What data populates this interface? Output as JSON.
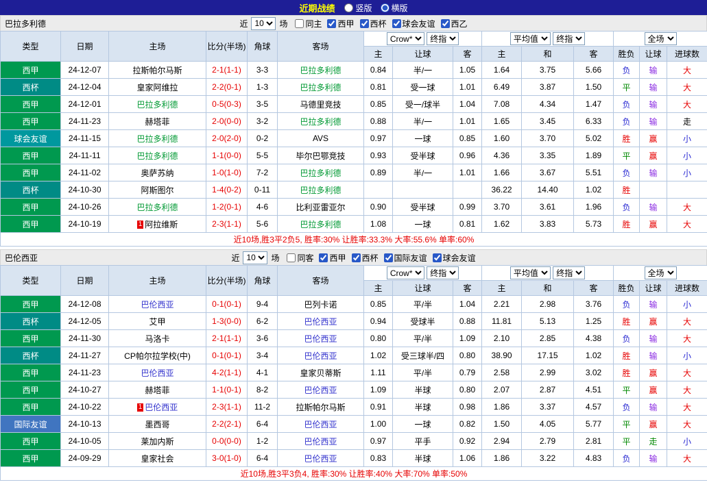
{
  "topbar": {
    "title": "近期战绩",
    "radio_options": [
      {
        "label": "竖版",
        "selected": false
      },
      {
        "label": "横版",
        "selected": true
      }
    ]
  },
  "table_header": {
    "fixed": [
      "类型",
      "日期",
      "主场",
      "比分(半场)",
      "角球",
      "客场"
    ],
    "group1": {
      "selects": [
        "Crow*",
        "终指"
      ],
      "sub": [
        "主",
        "让球",
        "客"
      ]
    },
    "group2": {
      "selects": [
        "平均值",
        "终指"
      ],
      "sub": [
        "主",
        "和",
        "客"
      ]
    },
    "group3": {
      "selects": [
        "全场"
      ],
      "sub": [
        "胜负",
        "让球",
        "进球数"
      ]
    }
  },
  "colors": {
    "accent": "#2858c8",
    "score": "#e60000",
    "league": {
      "西甲": "#00994f",
      "西杯": "#008b85",
      "球会友谊": "#00989e",
      "国际友谊": "#4075c0"
    },
    "result": {
      "胜": "#e60000",
      "平": "#008800",
      "负": "#2a2ad2"
    },
    "handicap": {
      "赢": "#e60000",
      "输": "#8a2be2",
      "走": "#008800"
    },
    "goals": {
      "大": "#e60000",
      "小": "#2a2ad2"
    }
  },
  "sections": [
    {
      "team": "巴拉多利德",
      "team_color": "#009933",
      "filter": {
        "prefix": "近",
        "count": "10",
        "suffix": "场",
        "checkboxes": [
          {
            "label": "同主",
            "checked": false
          },
          {
            "label": "西甲",
            "checked": true
          },
          {
            "label": "西杯",
            "checked": true
          },
          {
            "label": "球会友谊",
            "checked": true
          },
          {
            "label": "西乙",
            "checked": true
          }
        ]
      },
      "rows": [
        {
          "league": "西甲",
          "date": "24-12-07",
          "home": "拉斯帕尔马斯",
          "home_is_team": false,
          "score": "2-1(1-1)",
          "corner": "3-3",
          "away": "巴拉多利德",
          "away_is_team": true,
          "asia": [
            "0.84",
            "半/一",
            "1.05"
          ],
          "europe": [
            "1.64",
            "3.75",
            "5.66"
          ],
          "result": "负",
          "handicap": "输",
          "goals": "大"
        },
        {
          "league": "西杯",
          "date": "24-12-04",
          "home": "皇家阿维拉",
          "home_is_team": false,
          "score": "2-2(0-1)",
          "corner": "1-3",
          "away": "巴拉多利德",
          "away_is_team": true,
          "asia": [
            "0.81",
            "受一球",
            "1.01"
          ],
          "europe": [
            "6.49",
            "3.87",
            "1.50"
          ],
          "result": "平",
          "handicap": "输",
          "goals": "大"
        },
        {
          "league": "西甲",
          "date": "24-12-01",
          "home": "巴拉多利德",
          "home_is_team": true,
          "score": "0-5(0-3)",
          "corner": "3-5",
          "away": "马德里竞技",
          "away_is_team": false,
          "asia": [
            "0.85",
            "受一/球半",
            "1.04"
          ],
          "europe": [
            "7.08",
            "4.34",
            "1.47"
          ],
          "result": "负",
          "handicap": "输",
          "goals": "大"
        },
        {
          "league": "西甲",
          "date": "24-11-23",
          "home": "赫塔菲",
          "home_is_team": false,
          "score": "2-0(0-0)",
          "corner": "3-2",
          "away": "巴拉多利德",
          "away_is_team": true,
          "asia": [
            "0.88",
            "半/一",
            "1.01"
          ],
          "europe": [
            "1.65",
            "3.45",
            "6.33"
          ],
          "result": "负",
          "handicap": "输",
          "goals": "走"
        },
        {
          "league": "球会友谊",
          "date": "24-11-15",
          "home": "巴拉多利德",
          "home_is_team": true,
          "score": "2-0(2-0)",
          "corner": "0-2",
          "away": "AVS",
          "away_is_team": false,
          "asia": [
            "0.97",
            "一球",
            "0.85"
          ],
          "europe": [
            "1.60",
            "3.70",
            "5.02"
          ],
          "result": "胜",
          "handicap": "赢",
          "goals": "小"
        },
        {
          "league": "西甲",
          "date": "24-11-11",
          "home": "巴拉多利德",
          "home_is_team": true,
          "score": "1-1(0-0)",
          "corner": "5-5",
          "away": "毕尔巴鄂竞技",
          "away_is_team": false,
          "asia": [
            "0.93",
            "受半球",
            "0.96"
          ],
          "europe": [
            "4.36",
            "3.35",
            "1.89"
          ],
          "result": "平",
          "handicap": "赢",
          "goals": "小"
        },
        {
          "league": "西甲",
          "date": "24-11-02",
          "home": "奥萨苏纳",
          "home_is_team": false,
          "score": "1-0(1-0)",
          "corner": "7-2",
          "away": "巴拉多利德",
          "away_is_team": true,
          "asia": [
            "0.89",
            "半/一",
            "1.01"
          ],
          "europe": [
            "1.66",
            "3.67",
            "5.51"
          ],
          "result": "负",
          "handicap": "输",
          "goals": "小"
        },
        {
          "league": "西杯",
          "date": "24-10-30",
          "home": "阿斯图尔",
          "home_is_team": false,
          "score": "1-4(0-2)",
          "corner": "0-11",
          "away": "巴拉多利德",
          "away_is_team": true,
          "asia": [
            "",
            "",
            ""
          ],
          "europe": [
            "36.22",
            "14.40",
            "1.02"
          ],
          "result": "胜",
          "handicap": "",
          "goals": ""
        },
        {
          "league": "西甲",
          "date": "24-10-26",
          "home": "巴拉多利德",
          "home_is_team": true,
          "score": "1-2(0-1)",
          "corner": "4-6",
          "away": "比利亚雷亚尔",
          "away_is_team": false,
          "asia": [
            "0.90",
            "受半球",
            "0.99"
          ],
          "europe": [
            "3.70",
            "3.61",
            "1.96"
          ],
          "result": "负",
          "handicap": "输",
          "goals": "大"
        },
        {
          "league": "西甲",
          "date": "24-10-19",
          "home": "阿拉维斯",
          "home_is_team": false,
          "home_badge": "1",
          "score": "2-3(1-1)",
          "corner": "5-6",
          "away": "巴拉多利德",
          "away_is_team": true,
          "asia": [
            "1.08",
            "一球",
            "0.81"
          ],
          "europe": [
            "1.62",
            "3.83",
            "5.73"
          ],
          "result": "胜",
          "handicap": "赢",
          "goals": "大"
        }
      ],
      "summary": "近10场,胜3平2负5, 胜率:30% 让胜率:33.3% 大率:55.6% 单率:60%"
    },
    {
      "team": "巴伦西亚",
      "team_color": "#3232cd",
      "filter": {
        "prefix": "近",
        "count": "10",
        "suffix": "场",
        "checkboxes": [
          {
            "label": "同客",
            "checked": false
          },
          {
            "label": "西甲",
            "checked": true
          },
          {
            "label": "西杯",
            "checked": true
          },
          {
            "label": "国际友谊",
            "checked": true
          },
          {
            "label": "球会友谊",
            "checked": true
          }
        ]
      },
      "rows": [
        {
          "league": "西甲",
          "date": "24-12-08",
          "home": "巴伦西亚",
          "home_is_team": true,
          "score": "0-1(0-1)",
          "corner": "9-4",
          "away": "巴列卡诺",
          "away_is_team": false,
          "asia": [
            "0.85",
            "平/半",
            "1.04"
          ],
          "europe": [
            "2.21",
            "2.98",
            "3.76"
          ],
          "result": "负",
          "handicap": "输",
          "goals": "小"
        },
        {
          "league": "西杯",
          "date": "24-12-05",
          "home": "艾甲",
          "home_is_team": false,
          "score": "1-3(0-0)",
          "corner": "6-2",
          "away": "巴伦西亚",
          "away_is_team": true,
          "asia": [
            "0.94",
            "受球半",
            "0.88"
          ],
          "europe": [
            "11.81",
            "5.13",
            "1.25"
          ],
          "result": "胜",
          "handicap": "赢",
          "goals": "大"
        },
        {
          "league": "西甲",
          "date": "24-11-30",
          "home": "马洛卡",
          "home_is_team": false,
          "score": "2-1(1-1)",
          "corner": "3-6",
          "away": "巴伦西亚",
          "away_is_team": true,
          "asia": [
            "0.80",
            "平/半",
            "1.09"
          ],
          "europe": [
            "2.10",
            "2.85",
            "4.38"
          ],
          "result": "负",
          "handicap": "输",
          "goals": "大"
        },
        {
          "league": "西杯",
          "date": "24-11-27",
          "home": "CP帕尔拉学校(中)",
          "home_is_team": false,
          "score": "0-1(0-1)",
          "corner": "3-4",
          "away": "巴伦西亚",
          "away_is_team": true,
          "asia": [
            "1.02",
            "受三球半/四",
            "0.80"
          ],
          "europe": [
            "38.90",
            "17.15",
            "1.02"
          ],
          "result": "胜",
          "handicap": "输",
          "goals": "小"
        },
        {
          "league": "西甲",
          "date": "24-11-23",
          "home": "巴伦西亚",
          "home_is_team": true,
          "score": "4-2(1-1)",
          "corner": "4-1",
          "away": "皇家贝蒂斯",
          "away_is_team": false,
          "asia": [
            "1.11",
            "平/半",
            "0.79"
          ],
          "europe": [
            "2.58",
            "2.99",
            "3.02"
          ],
          "result": "胜",
          "handicap": "赢",
          "goals": "大"
        },
        {
          "league": "西甲",
          "date": "24-10-27",
          "home": "赫塔菲",
          "home_is_team": false,
          "score": "1-1(0-1)",
          "corner": "8-2",
          "away": "巴伦西亚",
          "away_is_team": true,
          "asia": [
            "1.09",
            "半球",
            "0.80"
          ],
          "europe": [
            "2.07",
            "2.87",
            "4.51"
          ],
          "result": "平",
          "handicap": "赢",
          "goals": "大"
        },
        {
          "league": "西甲",
          "date": "24-10-22",
          "home": "巴伦西亚",
          "home_is_team": true,
          "home_badge": "1",
          "score": "2-3(1-1)",
          "corner": "11-2",
          "away": "拉斯帕尔马斯",
          "away_is_team": false,
          "asia": [
            "0.91",
            "半球",
            "0.98"
          ],
          "europe": [
            "1.86",
            "3.37",
            "4.57"
          ],
          "result": "负",
          "handicap": "输",
          "goals": "大"
        },
        {
          "league": "国际友谊",
          "date": "24-10-13",
          "home": "墨西哥",
          "home_is_team": false,
          "score": "2-2(2-1)",
          "corner": "6-4",
          "away": "巴伦西亚",
          "away_is_team": true,
          "asia": [
            "1.00",
            "一球",
            "0.82"
          ],
          "europe": [
            "1.50",
            "4.05",
            "5.77"
          ],
          "result": "平",
          "handicap": "赢",
          "goals": "大"
        },
        {
          "league": "西甲",
          "date": "24-10-05",
          "home": "莱加内斯",
          "home_is_team": false,
          "score": "0-0(0-0)",
          "corner": "1-2",
          "away": "巴伦西亚",
          "away_is_team": true,
          "asia": [
            "0.97",
            "平手",
            "0.92"
          ],
          "europe": [
            "2.94",
            "2.79",
            "2.81"
          ],
          "result": "平",
          "handicap": "走",
          "goals": "小"
        },
        {
          "league": "西甲",
          "date": "24-09-29",
          "home": "皇家社会",
          "home_is_team": false,
          "score": "3-0(1-0)",
          "corner": "6-4",
          "away": "巴伦西亚",
          "away_is_team": true,
          "asia": [
            "0.83",
            "半球",
            "1.06"
          ],
          "europe": [
            "1.86",
            "3.22",
            "4.83"
          ],
          "result": "负",
          "handicap": "输",
          "goals": "大"
        }
      ],
      "summary": "近10场,胜3平3负4, 胜率:30% 让胜率:40% 大率:70% 单率:50%"
    }
  ]
}
